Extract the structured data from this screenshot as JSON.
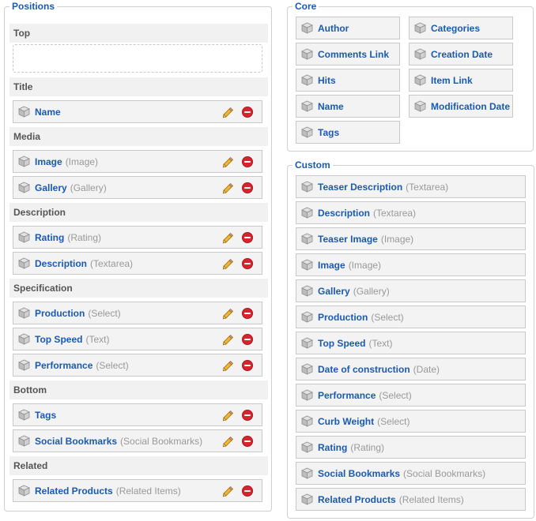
{
  "positions": {
    "legend": "Positions",
    "groups": [
      {
        "name": "Top",
        "items": []
      },
      {
        "name": "Title",
        "items": [
          {
            "name": "Name",
            "type": ""
          }
        ]
      },
      {
        "name": "Media",
        "items": [
          {
            "name": "Image",
            "type": "(Image)"
          },
          {
            "name": "Gallery",
            "type": "(Gallery)"
          }
        ]
      },
      {
        "name": "Description",
        "items": [
          {
            "name": "Rating",
            "type": "(Rating)"
          },
          {
            "name": "Description",
            "type": "(Textarea)"
          }
        ]
      },
      {
        "name": "Specification",
        "items": [
          {
            "name": "Production",
            "type": "(Select)"
          },
          {
            "name": "Top Speed",
            "type": "(Text)"
          },
          {
            "name": "Performance",
            "type": "(Select)"
          }
        ]
      },
      {
        "name": "Bottom",
        "items": [
          {
            "name": "Tags",
            "type": ""
          },
          {
            "name": "Social Bookmarks",
            "type": "(Social Bookmarks)"
          }
        ]
      },
      {
        "name": "Related",
        "items": [
          {
            "name": "Related Products",
            "type": "(Related Items)"
          }
        ]
      }
    ]
  },
  "core": {
    "legend": "Core",
    "items": [
      "Author",
      "Categories",
      "Comments Link",
      "Creation Date",
      "Hits",
      "Item Link",
      "Name",
      "Modification Date",
      "Tags"
    ]
  },
  "custom": {
    "legend": "Custom",
    "items": [
      {
        "name": "Teaser Description",
        "type": "(Textarea)"
      },
      {
        "name": "Description",
        "type": "(Textarea)"
      },
      {
        "name": "Teaser Image",
        "type": "(Image)"
      },
      {
        "name": "Image",
        "type": "(Image)"
      },
      {
        "name": "Gallery",
        "type": "(Gallery)"
      },
      {
        "name": "Production",
        "type": "(Select)"
      },
      {
        "name": "Top Speed",
        "type": "(Text)"
      },
      {
        "name": "Date of construction",
        "type": "(Date)"
      },
      {
        "name": "Performance",
        "type": "(Select)"
      },
      {
        "name": "Curb Weight",
        "type": "(Select)"
      },
      {
        "name": "Rating",
        "type": "(Rating)"
      },
      {
        "name": "Social Bookmarks",
        "type": "(Social Bookmarks)"
      },
      {
        "name": "Related Products",
        "type": "(Related Items)"
      }
    ]
  },
  "icons": {
    "element": "cube-icon",
    "edit": "pencil-icon",
    "delete": "remove-icon"
  },
  "colors": {
    "accent": "#1a5ab0",
    "type_text": "#999999",
    "delete": "#d9232e",
    "pencil": "#e8a317"
  }
}
